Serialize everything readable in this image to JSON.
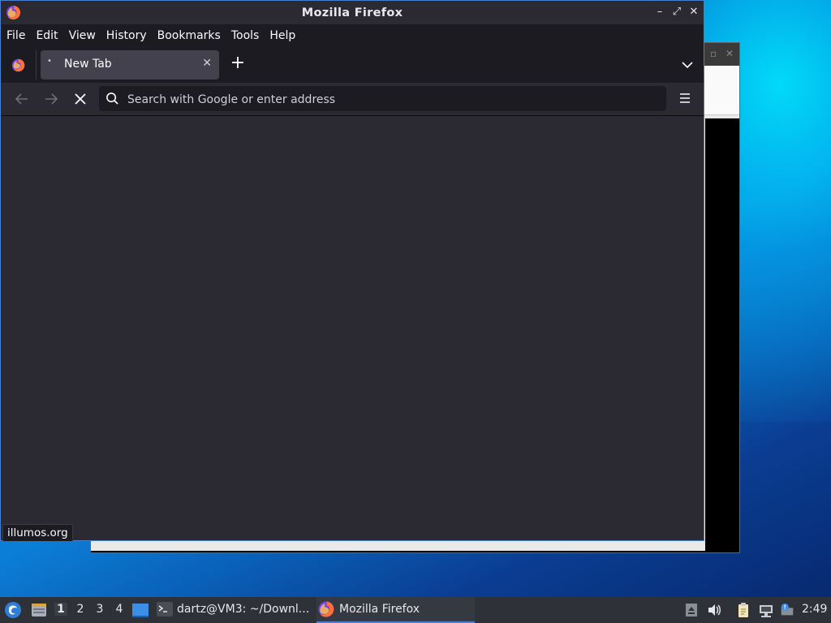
{
  "firefox": {
    "window_title": "Mozilla Firefox",
    "menu": [
      "File",
      "Edit",
      "View",
      "History",
      "Bookmarks",
      "Tools",
      "Help"
    ],
    "tab": {
      "label": "New Tab"
    },
    "urlbar": {
      "placeholder": "Search with Google or enter address",
      "value": ""
    },
    "status_text": "illumos.org"
  },
  "taskbar": {
    "workspaces": [
      "1",
      "2",
      "3",
      "4"
    ],
    "active_workspace": "1",
    "tasks": [
      {
        "label": "dartz@VM3: ~/Downl...",
        "icon": "terminal-icon"
      },
      {
        "label": "Mozilla Firefox",
        "icon": "firefox-icon"
      }
    ],
    "clock": "2:49"
  },
  "colors": {
    "accent": "#4a7fd0",
    "ff_toolbar": "#2b2a33",
    "ff_tabstrip": "#1c1b22",
    "taskbar_bg": "#2e3138"
  }
}
